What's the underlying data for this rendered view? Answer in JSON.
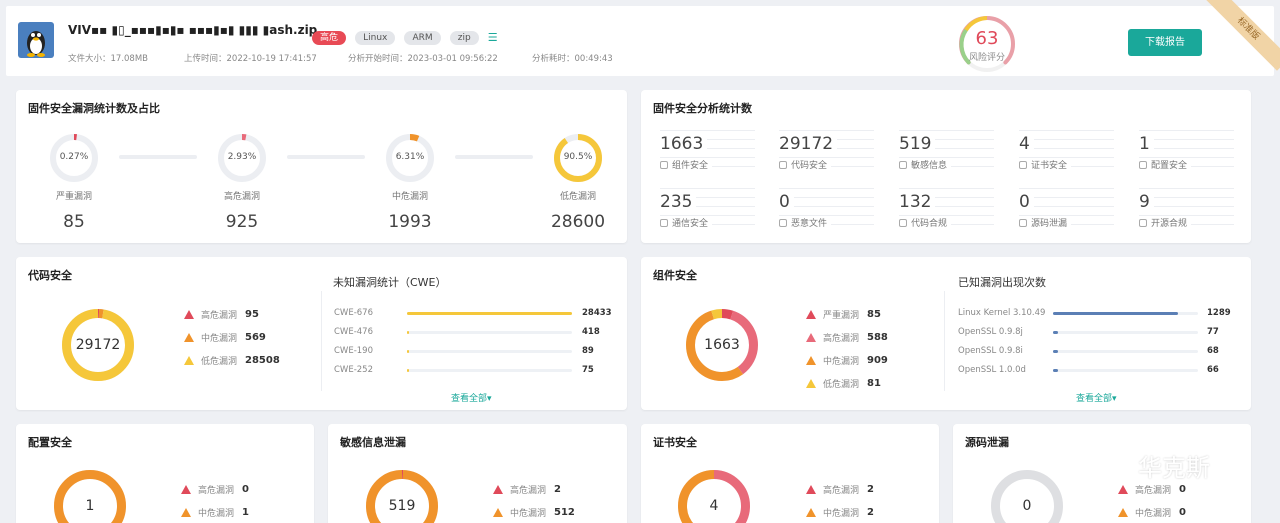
{
  "header": {
    "filename": "VIV▪▪ ▮▯_▪▪▪▮▪▮▪ ▪▪▪▮▪▮ ▮▮▮ ▮ash.zip",
    "tags": [
      "高危",
      "Linux",
      "ARM",
      "zip"
    ],
    "file_size": "文件大小：17.08MB",
    "upload_time": "上传时间：2022-10-19 17:41:57",
    "analysis_start": "分析开始时间：2023-03-01 09:56:22",
    "analysis_duration": "分析耗时：00:49:43",
    "risk_score": "63",
    "risk_label": "风险评分",
    "download_label": "下载报告",
    "edition_label": "标准版"
  },
  "vuln_stats": {
    "title": "固件安全漏洞统计数及占比",
    "items": [
      {
        "pct": "0.27%",
        "label": "严重漏洞",
        "count": "85",
        "fraction": 0.0027,
        "color": "#e04a5a"
      },
      {
        "pct": "2.93%",
        "label": "高危漏洞",
        "count": "925",
        "fraction": 0.0293,
        "color": "#e86a7a"
      },
      {
        "pct": "6.31%",
        "label": "中危漏洞",
        "count": "1993",
        "fraction": 0.0631,
        "color": "#f0932b"
      },
      {
        "pct": "90.5%",
        "label": "低危漏洞",
        "count": "28600",
        "fraction": 0.905,
        "color": "#f5c73a"
      }
    ]
  },
  "analysis_stats": {
    "title": "固件安全分析统计数",
    "items": [
      {
        "value": "1663",
        "label": "组件安全",
        "icon": "component-icon"
      },
      {
        "value": "29172",
        "label": "代码安全",
        "icon": "shield-icon"
      },
      {
        "value": "519",
        "label": "敏感信息",
        "icon": "document-icon"
      },
      {
        "value": "4",
        "label": "证书安全",
        "icon": "certificate-icon"
      },
      {
        "value": "1",
        "label": "配置安全",
        "icon": "settings-icon"
      },
      {
        "value": "235",
        "label": "通信安全",
        "icon": "signal-icon"
      },
      {
        "value": "0",
        "label": "恶意文件",
        "icon": "file-icon"
      },
      {
        "value": "132",
        "label": "代码合规",
        "icon": "code-icon"
      },
      {
        "value": "0",
        "label": "源码泄漏",
        "icon": "source-icon"
      },
      {
        "value": "9",
        "label": "开源合规",
        "icon": "opensource-icon"
      }
    ]
  },
  "code_security": {
    "title": "代码安全",
    "total": "29172",
    "legend": [
      {
        "label": "高危漏洞",
        "value": "95",
        "color": "#e04a5a"
      },
      {
        "label": "中危漏洞",
        "value": "569",
        "color": "#f0932b"
      },
      {
        "label": "低危漏洞",
        "value": "28508",
        "color": "#f5c73a"
      }
    ],
    "cwe_title": "未知漏洞统计（CWE）",
    "cwe": [
      {
        "name": "CWE-676",
        "value": "28433",
        "fraction": 1.0
      },
      {
        "name": "CWE-476",
        "value": "418",
        "fraction": 0.015
      },
      {
        "name": "CWE-190",
        "value": "89",
        "fraction": 0.003
      },
      {
        "name": "CWE-252",
        "value": "75",
        "fraction": 0.003
      }
    ],
    "view_all": "查看全部▾"
  },
  "component_security": {
    "title": "组件安全",
    "total": "1663",
    "legend": [
      {
        "label": "严重漏洞",
        "value": "85",
        "color": "#e04a5a"
      },
      {
        "label": "高危漏洞",
        "value": "588",
        "color": "#e86a7a"
      },
      {
        "label": "中危漏洞",
        "value": "909",
        "color": "#f0932b"
      },
      {
        "label": "低危漏洞",
        "value": "81",
        "color": "#f5c73a"
      }
    ],
    "known_title": "已知漏洞出现次数",
    "known": [
      {
        "name": "Linux Kernel 3.10.49",
        "value": "1289",
        "fraction": 0.86
      },
      {
        "name": "OpenSSL 0.9.8j",
        "value": "77",
        "fraction": 0.035
      },
      {
        "name": "OpenSSL 0.9.8i",
        "value": "68",
        "fraction": 0.03
      },
      {
        "name": "OpenSSL 1.0.0d",
        "value": "66",
        "fraction": 0.03
      }
    ],
    "view_all": "查看全部▾"
  },
  "config_security": {
    "title": "配置安全",
    "total": "1",
    "legend": [
      {
        "label": "高危漏洞",
        "value": "0"
      },
      {
        "label": "中危漏洞",
        "value": "1"
      }
    ]
  },
  "sensitive_leak": {
    "title": "敏感信息泄漏",
    "total": "519",
    "legend": [
      {
        "label": "高危漏洞",
        "value": "2"
      },
      {
        "label": "中危漏洞",
        "value": "512"
      }
    ]
  },
  "cert_security": {
    "title": "证书安全",
    "total": "4",
    "legend": [
      {
        "label": "高危漏洞",
        "value": "2"
      },
      {
        "label": "中危漏洞",
        "value": "2"
      }
    ]
  },
  "source_leak": {
    "title": "源码泄漏",
    "total": "0",
    "legend": [
      {
        "label": "高危漏洞",
        "value": "0"
      },
      {
        "label": "中危漏洞",
        "value": "0"
      }
    ]
  },
  "watermark": {
    "text": "华克斯"
  }
}
